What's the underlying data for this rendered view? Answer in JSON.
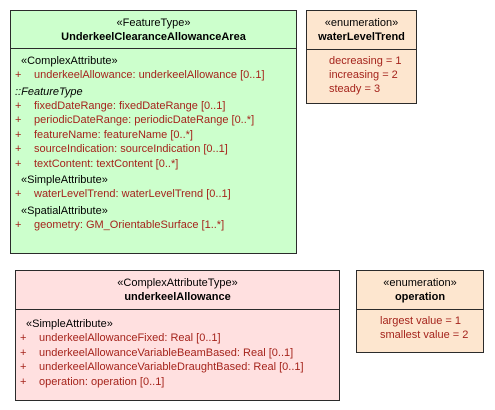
{
  "feature_class": {
    "stereotype": "«FeatureType»",
    "name": "UnderkeelClearanceAllowanceArea",
    "groups": [
      {
        "label": "«ComplexAttribute»",
        "italic": false,
        "attributes": [
          {
            "vis": "+",
            "text": "underkeelAllowance: underkeelAllowance [0..1]"
          }
        ]
      },
      {
        "label": "::FeatureType",
        "italic": true,
        "attributes": [
          {
            "vis": "+",
            "text": "fixedDateRange: fixedDateRange [0..1]"
          },
          {
            "vis": "+",
            "text": "periodicDateRange: periodicDateRange [0..*]"
          },
          {
            "vis": "+",
            "text": "featureName: featureName [0..*]"
          },
          {
            "vis": "+",
            "text": "sourceIndication: sourceIndication [0..1]"
          },
          {
            "vis": "+",
            "text": "textContent: textContent [0..*]"
          }
        ]
      },
      {
        "label": "«SimpleAttribute»",
        "italic": false,
        "attributes": [
          {
            "vis": "+",
            "text": "waterLevelTrend: waterLevelTrend [0..1]"
          }
        ]
      },
      {
        "label": "«SpatialAttribute»",
        "italic": false,
        "attributes": [
          {
            "vis": "+",
            "text": "geometry: GM_OrientableSurface [1..*]"
          }
        ]
      }
    ]
  },
  "water_level_trend": {
    "stereotype": "«enumeration»",
    "name": "waterLevelTrend",
    "literals": [
      "decreasing = 1",
      "increasing = 2",
      "steady = 3"
    ]
  },
  "complex_attribute_type": {
    "stereotype": "«ComplexAttributeType»",
    "name": "underkeelAllowance",
    "groups": [
      {
        "label": "«SimpleAttribute»",
        "italic": false,
        "attributes": [
          {
            "vis": "+",
            "text": "underkeelAllowanceFixed: Real [0..1]"
          },
          {
            "vis": "+",
            "text": "underkeelAllowanceVariableBeamBased: Real [0..1]"
          },
          {
            "vis": "+",
            "text": "underkeelAllowanceVariableDraughtBased: Real [0..1]"
          },
          {
            "vis": "+",
            "text": "operation: operation [0..1]"
          }
        ]
      }
    ]
  },
  "operation_enum": {
    "stereotype": "«enumeration»",
    "name": "operation",
    "literals": [
      "largest value = 1",
      "smallest value = 2"
    ]
  }
}
